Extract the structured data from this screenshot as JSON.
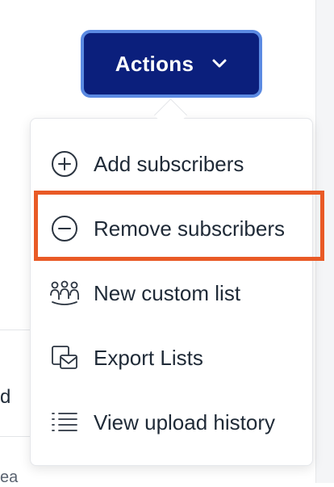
{
  "actions_button": {
    "label": "Actions",
    "icon": "chevron-down-icon"
  },
  "menu": {
    "items": [
      {
        "label": "Add subscribers",
        "icon": "plus-circle-icon"
      },
      {
        "label": "Remove subscribers",
        "icon": "minus-circle-icon",
        "highlighted": true
      },
      {
        "label": "New custom list",
        "icon": "people-group-icon"
      },
      {
        "label": "Export Lists",
        "icon": "export-icon"
      },
      {
        "label": "View upload history",
        "icon": "list-icon"
      }
    ]
  },
  "background": {
    "fragment_1": "d",
    "fragment_2": "ea"
  },
  "colors": {
    "button_bg": "#0b1f7c",
    "button_border": "#5b8ae2",
    "highlight": "#e95a26",
    "text": "#1f2a37"
  }
}
